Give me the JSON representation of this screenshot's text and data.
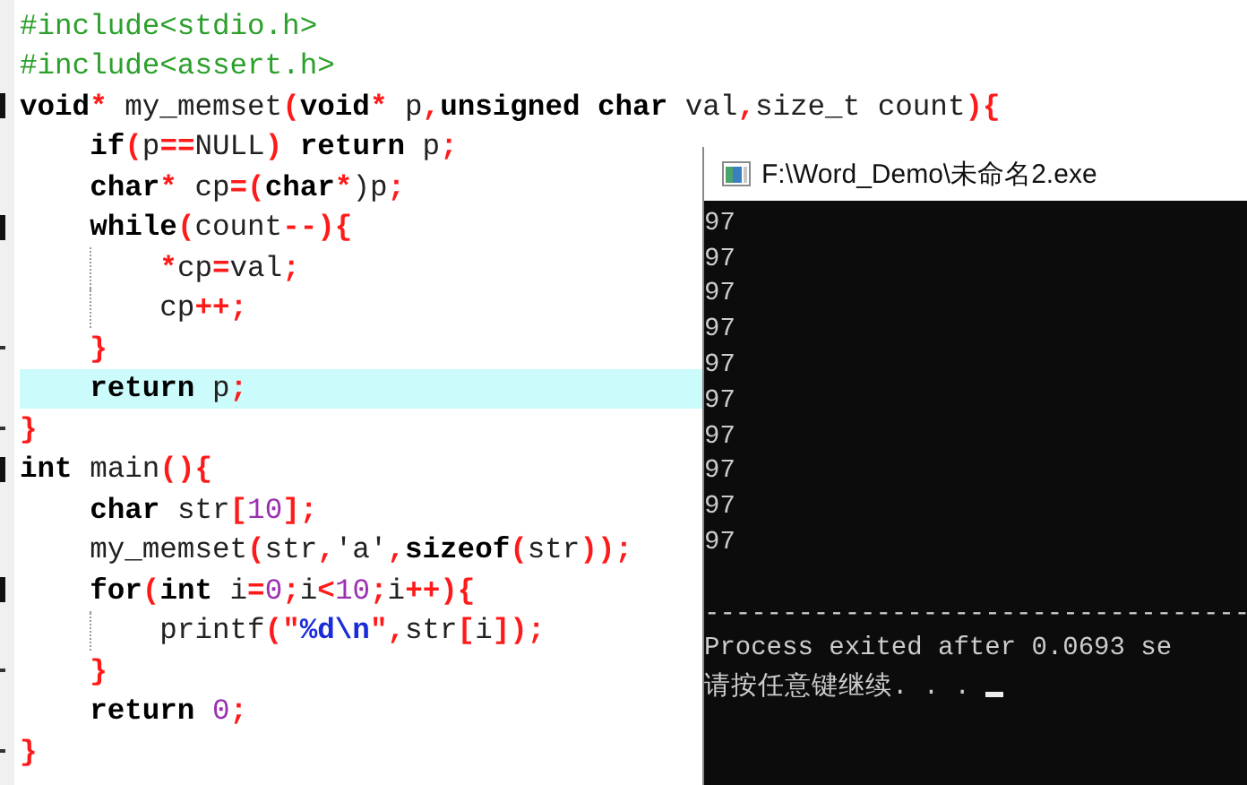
{
  "editor": {
    "lines": [
      {
        "fold_start": false,
        "fold_end": false,
        "highlighted": false,
        "guide": false,
        "tokens": [
          {
            "kind": "pre",
            "text": "#include<stdio.h>"
          }
        ]
      },
      {
        "fold_start": false,
        "fold_end": false,
        "highlighted": false,
        "guide": false,
        "tokens": [
          {
            "kind": "pre",
            "text": "#include<assert.h>"
          }
        ]
      },
      {
        "fold_start": true,
        "fold_end": false,
        "highlighted": false,
        "guide": false,
        "tokens": [
          {
            "kind": "kw",
            "text": "void"
          },
          {
            "kind": "op",
            "text": "*"
          },
          {
            "kind": "plain",
            "text": " my_memset"
          },
          {
            "kind": "op",
            "text": "("
          },
          {
            "kind": "kw",
            "text": "void"
          },
          {
            "kind": "op",
            "text": "*"
          },
          {
            "kind": "plain",
            "text": " p"
          },
          {
            "kind": "op",
            "text": ","
          },
          {
            "kind": "kw",
            "text": "unsigned char"
          },
          {
            "kind": "plain",
            "text": " val"
          },
          {
            "kind": "op",
            "text": ","
          },
          {
            "kind": "plain",
            "text": "size_t count"
          },
          {
            "kind": "op",
            "text": "){"
          }
        ]
      },
      {
        "fold_start": false,
        "fold_end": false,
        "highlighted": false,
        "guide": false,
        "tokens": [
          {
            "kind": "kw",
            "text": "    if"
          },
          {
            "kind": "op",
            "text": "("
          },
          {
            "kind": "plain",
            "text": "p"
          },
          {
            "kind": "op",
            "text": "=="
          },
          {
            "kind": "plain",
            "text": "NULL"
          },
          {
            "kind": "op",
            "text": ")"
          },
          {
            "kind": "kw",
            "text": " return"
          },
          {
            "kind": "plain",
            "text": " p"
          },
          {
            "kind": "op",
            "text": ";"
          }
        ]
      },
      {
        "fold_start": false,
        "fold_end": false,
        "highlighted": false,
        "guide": false,
        "tokens": [
          {
            "kind": "kw",
            "text": "    char"
          },
          {
            "kind": "op",
            "text": "*"
          },
          {
            "kind": "plain",
            "text": " cp"
          },
          {
            "kind": "op",
            "text": "=("
          },
          {
            "kind": "kw",
            "text": "char"
          },
          {
            "kind": "op",
            "text": "*"
          },
          {
            "kind": "plain",
            "text": ")p"
          },
          {
            "kind": "op",
            "text": ";"
          }
        ]
      },
      {
        "fold_start": true,
        "fold_end": false,
        "highlighted": false,
        "guide": false,
        "tokens": [
          {
            "kind": "kw",
            "text": "    while"
          },
          {
            "kind": "op",
            "text": "("
          },
          {
            "kind": "plain",
            "text": "count"
          },
          {
            "kind": "op",
            "text": "--){"
          }
        ]
      },
      {
        "fold_start": false,
        "fold_end": false,
        "highlighted": false,
        "guide": true,
        "tokens": [
          {
            "kind": "op",
            "text": "        *"
          },
          {
            "kind": "plain",
            "text": "cp"
          },
          {
            "kind": "op",
            "text": "="
          },
          {
            "kind": "plain",
            "text": "val"
          },
          {
            "kind": "op",
            "text": ";"
          }
        ]
      },
      {
        "fold_start": false,
        "fold_end": false,
        "highlighted": false,
        "guide": true,
        "tokens": [
          {
            "kind": "plain",
            "text": "        cp"
          },
          {
            "kind": "op",
            "text": "++;"
          }
        ]
      },
      {
        "fold_start": false,
        "fold_end": true,
        "highlighted": false,
        "guide": false,
        "tokens": [
          {
            "kind": "op",
            "text": "    }"
          }
        ]
      },
      {
        "fold_start": false,
        "fold_end": false,
        "highlighted": true,
        "guide": false,
        "tokens": [
          {
            "kind": "kw",
            "text": "    return"
          },
          {
            "kind": "plain",
            "text": " p"
          },
          {
            "kind": "op",
            "text": ";"
          }
        ]
      },
      {
        "fold_start": false,
        "fold_end": true,
        "highlighted": false,
        "guide": false,
        "tokens": [
          {
            "kind": "op",
            "text": "}"
          }
        ]
      },
      {
        "fold_start": true,
        "fold_end": false,
        "highlighted": false,
        "guide": false,
        "tokens": [
          {
            "kind": "kw",
            "text": "int"
          },
          {
            "kind": "plain",
            "text": " main"
          },
          {
            "kind": "op",
            "text": "(){"
          }
        ]
      },
      {
        "fold_start": false,
        "fold_end": false,
        "highlighted": false,
        "guide": false,
        "tokens": [
          {
            "kind": "kw",
            "text": "    char"
          },
          {
            "kind": "plain",
            "text": " str"
          },
          {
            "kind": "op",
            "text": "["
          },
          {
            "kind": "num",
            "text": "10"
          },
          {
            "kind": "op",
            "text": "];"
          }
        ]
      },
      {
        "fold_start": false,
        "fold_end": false,
        "highlighted": false,
        "guide": false,
        "tokens": [
          {
            "kind": "plain",
            "text": "    my_memset"
          },
          {
            "kind": "op",
            "text": "("
          },
          {
            "kind": "plain",
            "text": "str"
          },
          {
            "kind": "op",
            "text": ","
          },
          {
            "kind": "plain",
            "text": "'a'"
          },
          {
            "kind": "op",
            "text": ","
          },
          {
            "kind": "kw",
            "text": "sizeof"
          },
          {
            "kind": "op",
            "text": "("
          },
          {
            "kind": "plain",
            "text": "str"
          },
          {
            "kind": "op",
            "text": "));"
          }
        ]
      },
      {
        "fold_start": true,
        "fold_end": false,
        "highlighted": false,
        "guide": false,
        "tokens": [
          {
            "kind": "kw",
            "text": "    for"
          },
          {
            "kind": "op",
            "text": "("
          },
          {
            "kind": "kw",
            "text": "int"
          },
          {
            "kind": "plain",
            "text": " i"
          },
          {
            "kind": "op",
            "text": "="
          },
          {
            "kind": "num",
            "text": "0"
          },
          {
            "kind": "op",
            "text": ";"
          },
          {
            "kind": "plain",
            "text": "i"
          },
          {
            "kind": "op",
            "text": "<"
          },
          {
            "kind": "num",
            "text": "10"
          },
          {
            "kind": "op",
            "text": ";"
          },
          {
            "kind": "plain",
            "text": "i"
          },
          {
            "kind": "op",
            "text": "++){"
          }
        ]
      },
      {
        "fold_start": false,
        "fold_end": false,
        "highlighted": false,
        "guide": true,
        "tokens": [
          {
            "kind": "plain",
            "text": "        printf"
          },
          {
            "kind": "op",
            "text": "(\""
          },
          {
            "kind": "str",
            "text": "%d\\n"
          },
          {
            "kind": "op",
            "text": "\","
          },
          {
            "kind": "plain",
            "text": "str"
          },
          {
            "kind": "op",
            "text": "["
          },
          {
            "kind": "plain",
            "text": "i"
          },
          {
            "kind": "op",
            "text": "]);"
          }
        ]
      },
      {
        "fold_start": false,
        "fold_end": true,
        "highlighted": false,
        "guide": false,
        "tokens": [
          {
            "kind": "op",
            "text": "    }"
          }
        ]
      },
      {
        "fold_start": false,
        "fold_end": false,
        "highlighted": false,
        "guide": false,
        "tokens": [
          {
            "kind": "kw",
            "text": "    return "
          },
          {
            "kind": "num",
            "text": "0"
          },
          {
            "kind": "op",
            "text": ";"
          }
        ]
      },
      {
        "fold_start": false,
        "fold_end": true,
        "highlighted": false,
        "guide": false,
        "tokens": [
          {
            "kind": "op",
            "text": "}"
          }
        ]
      }
    ]
  },
  "console": {
    "title": "F:\\Word_Demo\\未命名2.exe",
    "cursor": true,
    "output": [
      {
        "kind": "text",
        "text": "97"
      },
      {
        "kind": "text",
        "text": "97"
      },
      {
        "kind": "text",
        "text": "97"
      },
      {
        "kind": "text",
        "text": "97"
      },
      {
        "kind": "text",
        "text": "97"
      },
      {
        "kind": "text",
        "text": "97"
      },
      {
        "kind": "text",
        "text": "97"
      },
      {
        "kind": "text",
        "text": "97"
      },
      {
        "kind": "text",
        "text": "97"
      },
      {
        "kind": "text",
        "text": "97"
      },
      {
        "kind": "blank"
      },
      {
        "kind": "text",
        "text": "-----------------------------------"
      },
      {
        "kind": "text",
        "text": "Process exited after 0.0693 se"
      },
      {
        "kind": "prompt",
        "text": "请按任意键继续. . . "
      }
    ]
  }
}
